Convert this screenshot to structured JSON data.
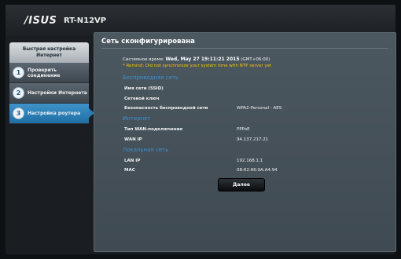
{
  "header": {
    "brand": "/ISUS",
    "model": "RT-N12VP"
  },
  "sidebar": {
    "title": "Быстрая настройка Интернет",
    "steps": [
      {
        "number": "1",
        "label": "Проверить соединение",
        "active": false
      },
      {
        "number": "2",
        "label": "Настройки Интернета",
        "active": false
      },
      {
        "number": "3",
        "label": "Настройка роутера",
        "active": true
      }
    ]
  },
  "main": {
    "title": "Сеть сконфигурирована",
    "system_time_label": "Системное время:",
    "system_time_value": "Wed, May 27 19:11:21 2015",
    "system_time_tz": "(GMT+06:00)",
    "remind": "* Remind: Did not synchronize your system time with NTP server yet",
    "sections": {
      "wireless": "Беспроводная сеть",
      "internet": "Интернет",
      "lan": "Локальная сеть"
    },
    "rows": {
      "ssid_label": "Имя сети (SSID)",
      "ssid_value": "",
      "key_label": "Сетевой ключ",
      "key_value": "",
      "security_label": "Безопасность беспроводной сети",
      "security_value": "WPA2-Personal - AES",
      "wan_type_label": "Тип WAN-подключения",
      "wan_type_value": "PPPoE",
      "wan_ip_label": "WAN IP",
      "wan_ip_value": "94.137.217.21",
      "lan_ip_label": "LAN IP",
      "lan_ip_value": "192.168.1.1",
      "mac_label": "MAC",
      "mac_value": "08:62:66:9A:A4:94"
    },
    "next_label": "Далее"
  }
}
